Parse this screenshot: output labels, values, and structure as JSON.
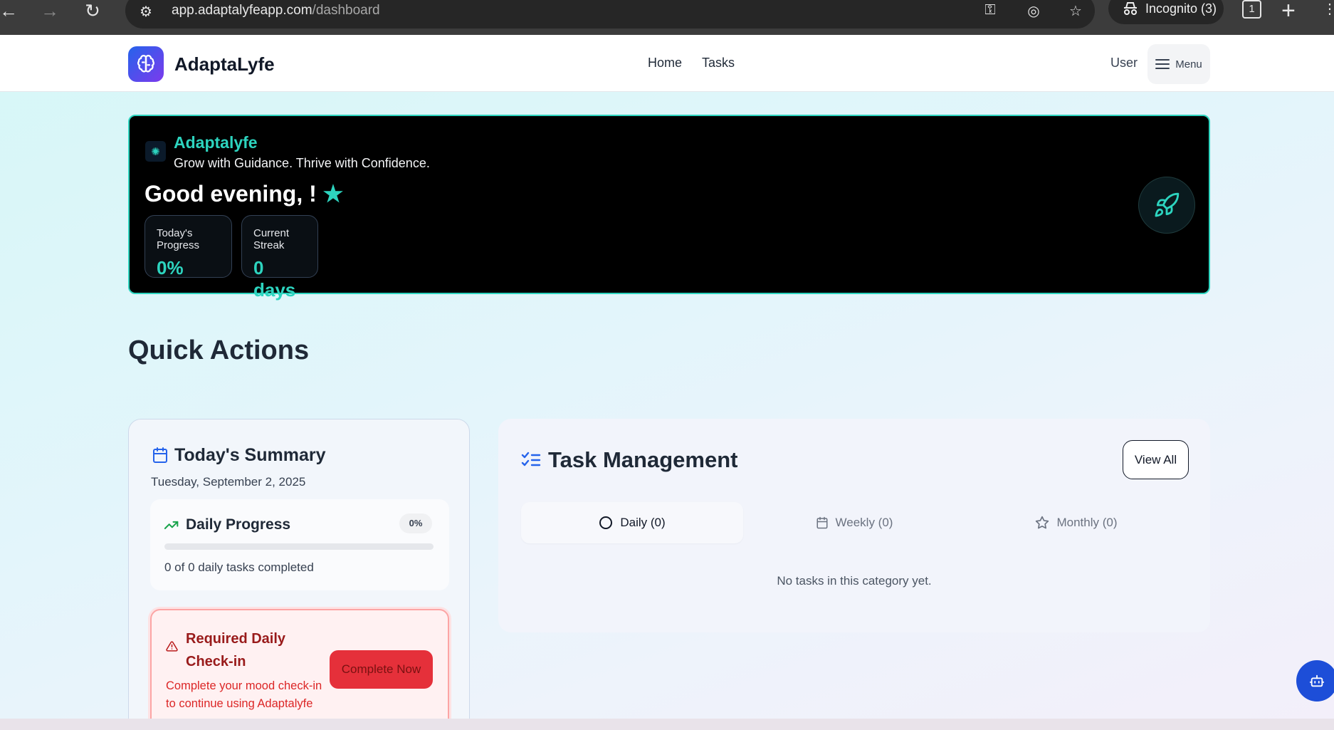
{
  "browser": {
    "url_host": "app.adaptalyfeapp.com",
    "url_path": "/dashboard",
    "incognito_label": "Incognito (3)",
    "tab_count": "1"
  },
  "header": {
    "brand": "AdaptaLyfe",
    "nav": [
      "Home",
      "Tasks"
    ],
    "user": "User",
    "menu_label": "Menu"
  },
  "hero": {
    "brand": "Adaptalyfe",
    "tagline": "Grow with Guidance. Thrive with Confidence.",
    "greeting": "Good evening, !",
    "star": "★",
    "stats": [
      {
        "label": "Today's Progress",
        "value": "0%"
      },
      {
        "label": "Current Streak",
        "value": "0 days"
      }
    ]
  },
  "quick_actions_title": "Quick Actions",
  "summary": {
    "title": "Today's Summary",
    "date": "Tuesday, September 2, 2025",
    "daily_progress": {
      "title": "Daily Progress",
      "percent_label": "0%",
      "progress": 0,
      "count_text": "0 of 0 daily tasks completed"
    },
    "required": {
      "title": "Required Daily Check-in",
      "description": "Complete your mood check-in to continue using Adaptalyfe",
      "button": "Complete Now"
    }
  },
  "tasks": {
    "title": "Task Management",
    "view_all": "View All",
    "tabs": [
      {
        "label": "Daily (0)",
        "icon": "circle-icon"
      },
      {
        "label": "Weekly (0)",
        "icon": "calendar-icon"
      },
      {
        "label": "Monthly (0)",
        "icon": "star-icon"
      }
    ],
    "empty_text": "No tasks in this category yet."
  },
  "colors": {
    "accent_teal": "#2dd4bf",
    "danger": "#e5303a",
    "brand_gradient": [
      "#2563eb",
      "#7c3aed"
    ]
  }
}
